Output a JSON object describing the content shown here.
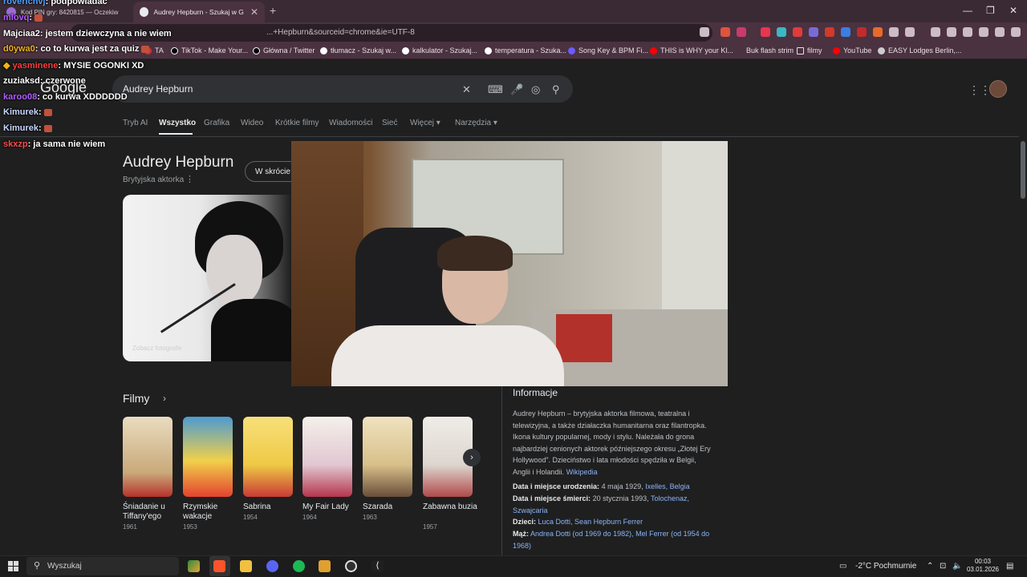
{
  "browser": {
    "tabs": [
      {
        "label": "Kod PIN gry: 8420815 — Oczekiw"
      },
      {
        "label": "Audrey Hepburn - Szukaj w Google"
      }
    ],
    "url": "...+Hepburn&sourceid=chrome&ie=UTF-8",
    "bookmarks": [
      "TA",
      "TikTok - Make Your...",
      "Główna / Twitter",
      "tłumacz - Szukaj w...",
      "kalkulator - Szukaj...",
      "temperatura - Szuka...",
      "Song Key & BPM Fi...",
      "THIS is WHY your Kl...",
      "Buk flash strim",
      "filmy",
      "YouTube",
      "EASY Lodges Berlin,..."
    ]
  },
  "google": {
    "logo": "Google",
    "query": "Audrey Hepburn",
    "nav": [
      "Tryb AI",
      "Wszystko",
      "Grafika",
      "Wideo",
      "Krótkie filmy",
      "Wiadomości",
      "Sieć",
      "Więcej",
      "Narzędzia"
    ]
  },
  "knowledge_panel": {
    "title": "Audrey Hepburn",
    "subtitle": "Brytyjska aktorka",
    "pill": "W skrócie",
    "image_caption": "Zobacz fotografie"
  },
  "films": {
    "heading": "Filmy",
    "items": [
      {
        "title": "Śniadanie u Tiffany'ego",
        "year": "1961",
        "color": "#d9c7a8"
      },
      {
        "title": "Rzymskie wakacje",
        "year": "1953",
        "color": "#5aa0c9"
      },
      {
        "title": "Sabrina",
        "year": "1954",
        "color": "#e8c45a"
      },
      {
        "title": "My Fair Lady",
        "year": "1964",
        "color": "#f0ede6"
      },
      {
        "title": "Szarada",
        "year": "1963",
        "color": "#e9d9b0"
      },
      {
        "title": "Zabawna buzia",
        "year": "1957",
        "color": "#ebe7e2"
      }
    ]
  },
  "info": {
    "heading": "Informacje",
    "description": "Audrey Hepburn – brytyjska aktorka filmowa, teatralna i telewizyjna, a także działaczka humanitarna oraz filantropka. Ikona kultury popularnej, mody i stylu. Należała do grona najbardziej cenionych aktorek późniejszego okresu „Złotej Ery Hollywood”. Dzieciństwo i lata młodości spędziła w Belgii, Anglii i Holandii.",
    "source": "Wikipedia",
    "rows": [
      {
        "label": "Data i miejsce urodzenia:",
        "plain": "4 maja 1929,",
        "links": "Ixelles, Belgia"
      },
      {
        "label": "Data i miejsce śmierci:",
        "plain": "20 stycznia 1993,",
        "links": "Tolochenaz, Szwajcaria"
      },
      {
        "label": "Dzieci:",
        "plain": "",
        "links": "Luca Dotti, Sean Hepburn Ferrer"
      },
      {
        "label": "Mąż:",
        "plain": "",
        "links": "Andrea Dotti (od 1969 do 1982), Mel Ferrer (od 1954 do 1968)"
      }
    ]
  },
  "chat": [
    {
      "user": "roverichvj",
      "user_color": "#4fa3ff",
      "message": ": podpowiadac"
    },
    {
      "user": "mlovq",
      "user_color": "#b35cff",
      "message": ":"
    },
    {
      "user": "Majciaa2",
      "user_color": "#ffffff",
      "message": ": jestem dziewczyna a nie wiem"
    },
    {
      "user": "d0ywa0",
      "user_color": "#f2b31a",
      "message": ": co to kurwa jest za quiz"
    },
    {
      "user": "yasminene",
      "user_color": "#ff3d3d",
      "message": ": MYSIE OGONKI XD"
    },
    {
      "user": "zuziaksd",
      "user_color": "#ffffff",
      "message": ": czerwone"
    },
    {
      "user": "karoo08",
      "user_color": "#b35cff",
      "message": ": co kurwa XDDDDDD"
    },
    {
      "user": "Kimurek",
      "user_color": "#c8d6ff",
      "message": ":"
    },
    {
      "user": "Kimurek",
      "user_color": "#c8d6ff",
      "message": ":"
    },
    {
      "user": "skxzp",
      "user_color": "#ff4d4d",
      "message": ": ja sama nie wiem"
    }
  ],
  "taskbar": {
    "search_placeholder": "Wyszukaj",
    "weather": "-2°C  Pochmurnie",
    "time": "00:03",
    "date": "03.01.2026"
  }
}
